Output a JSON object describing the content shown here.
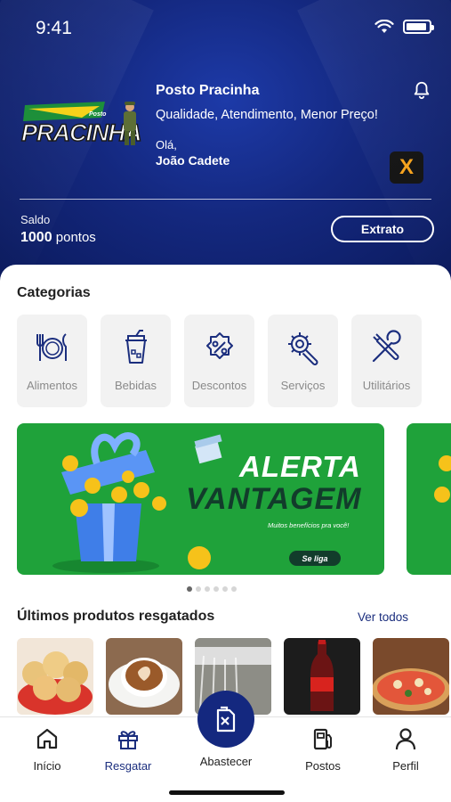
{
  "status_bar": {
    "time": "9:41"
  },
  "header": {
    "logo_text": "PRACINHA",
    "logo_small": "Posto",
    "shop_name": "Posto Pracinha",
    "tagline": "Qualidade, Atendimento, Menor Preço!",
    "greeting": "Olá,",
    "user_name": "João Cadete",
    "partner_badge": "X",
    "saldo_label": "Saldo",
    "saldo_points": "1000",
    "saldo_unit": "pontos",
    "extrato_label": "Extrato"
  },
  "categories": {
    "title": "Categorias",
    "items": [
      {
        "label": "Alimentos",
        "icon": "utensils-icon"
      },
      {
        "label": "Bebidas",
        "icon": "drink-cup-icon"
      },
      {
        "label": "Descontos",
        "icon": "percent-badge-icon"
      },
      {
        "label": "Serviços",
        "icon": "gear-wrench-icon"
      },
      {
        "label": "Utilitários",
        "icon": "tools-icon"
      }
    ]
  },
  "banner": {
    "title_line1": "ALERTA",
    "title_line2": "VANTAGEM",
    "subtitle": "Muitos benefícios pra você!",
    "cta": "Se liga",
    "colors": {
      "background": "#1fa23a",
      "dark": "#123c2b"
    },
    "carousel_pages": 6,
    "active_page": 1
  },
  "recent_products": {
    "title": "Últimos produtos resgatados",
    "see_all": "Ver todos",
    "items": [
      "pão de queijo",
      "café",
      "lavagem",
      "refrigerante",
      "pizza"
    ]
  },
  "bottom_nav": {
    "items": [
      {
        "label": "Início",
        "icon": "home-icon"
      },
      {
        "label": "Resgatar",
        "icon": "gift-icon",
        "active": true
      },
      {
        "label": "Abastecer",
        "icon": "fuel-can-icon"
      },
      {
        "label": "Postos",
        "icon": "gas-station-icon"
      },
      {
        "label": "Perfil",
        "icon": "user-icon"
      }
    ]
  },
  "colors": {
    "primary": "#14287f",
    "accent_active": "#1b2e7e"
  }
}
